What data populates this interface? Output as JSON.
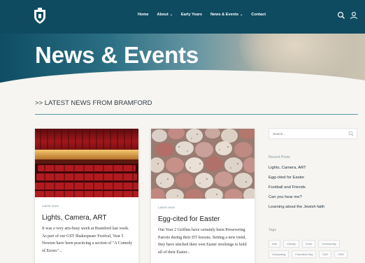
{
  "nav": {
    "items": [
      {
        "label": "Home",
        "dropdown": false
      },
      {
        "label": "About",
        "dropdown": true
      },
      {
        "label": "Early Years",
        "dropdown": false
      },
      {
        "label": "News & Events",
        "dropdown": true
      },
      {
        "label": "Contact",
        "dropdown": false
      }
    ],
    "icons": [
      "search-icon",
      "user-icon"
    ],
    "colors": {
      "bar": "#0f4b60",
      "text": "#ffffff"
    }
  },
  "hero": {
    "title": "News & Events"
  },
  "section": {
    "heading": ">> LATEST NEWS FROM BRAMFORD",
    "rule_color": "#5a9bab"
  },
  "cards": [
    {
      "image": "theatre-seats",
      "tag": "Latest news",
      "title": "Lights, Camera, ART",
      "excerpt": "It was a very arts-busy week at Bramford last week. As part of our GST Shakespeare Festival, Year 5 Newton have been practicing a section of \"A Comedy of Errors\"..."
    },
    {
      "image": "speckled-eggs",
      "tag": "Latest news",
      "title": "Egg-cited for Easter",
      "excerpt": "Our Year 2 Griffins have certainly been Persevering Parrots during their DT lessons. Setting a new trend, they have stitched their own Easter stockings to hold all of their Easter..."
    }
  ],
  "sidebar": {
    "search_placeholder": "Search...",
    "recent_title": "Recent Posts",
    "recent_posts": [
      "Lights, Camera, ART",
      "Egg-cited for Easter",
      "Football and Friends",
      "Can you hear me?",
      "Learning about the Jewish faith"
    ],
    "tags_title": "Tags",
    "tags": [
      "Arts",
      "Charity",
      "Choir",
      "Community",
      "Computing",
      "Founders Day",
      "GAT",
      "GSS"
    ]
  }
}
